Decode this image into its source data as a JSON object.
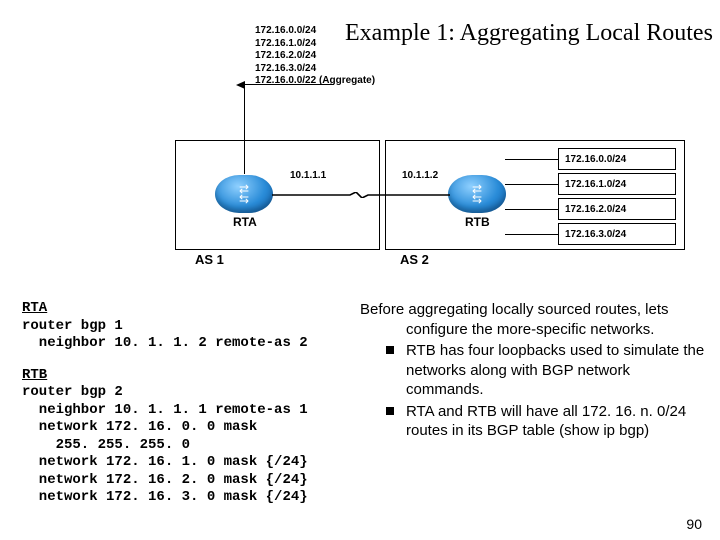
{
  "title": "Example 1: Aggregating Local Routes",
  "diagram": {
    "left_routes": [
      "172.16.0.0/24",
      "172.16.1.0/24",
      "172.16.2.0/24",
      "172.16.3.0/24",
      "172.16.0.0/22 (Aggregate)"
    ],
    "rta_label": "RTA",
    "rtb_label": "RTB",
    "ip_rta": "10.1.1.1",
    "ip_rtb": "10.1.1.2",
    "as1_label": "AS 1",
    "as2_label": "AS 2",
    "right_routes": [
      "172.16.0.0/24",
      "172.16.1.0/24",
      "172.16.2.0/24",
      "172.16.3.0/24"
    ]
  },
  "config": {
    "rta_h": "RTA",
    "rta": [
      "router bgp 1",
      "  neighbor 10. 1. 1. 2 remote-as 2"
    ],
    "rtb_h": "RTB",
    "rtb": [
      "router bgp 2",
      "  neighbor 10. 1. 1. 1 remote-as 1",
      "  network 172. 16. 0. 0 mask",
      "    255. 255. 255. 0",
      "  network 172. 16. 1. 0 mask {/24}",
      "  network 172. 16. 2. 0 mask {/24}",
      "  network 172. 16. 3. 0 mask {/24}"
    ]
  },
  "text": {
    "lead": "Before aggregating locally sourced routes, lets configure the more-specific networks.",
    "b1": "RTB has four loopbacks used to simulate the networks along with BGP network commands.",
    "b2": "RTA  and RTB will have all 172. 16. n. 0/24 routes in its BGP table (show ip bgp)"
  },
  "page": "90"
}
